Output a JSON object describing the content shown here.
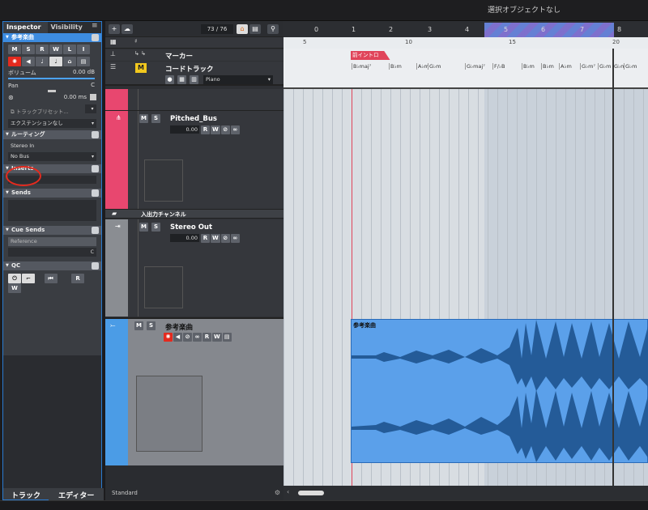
{
  "topbar": {
    "status": "選択オブジェクトなし"
  },
  "inspector": {
    "tabs": [
      "Inspector",
      "Visibility"
    ],
    "track_title": "参考楽曲",
    "buttons_row": [
      "M",
      "S",
      "R",
      "W",
      "L",
      "I"
    ],
    "volume_label": "ボリューム",
    "volume_value": "0.00 dB",
    "pan_label": "Pan",
    "pan_value": "C",
    "delay_value": "0.00 ms",
    "preset_label": "トラックプリセット...",
    "extension_label": "エクステンションなし",
    "routing_label": "ルーティング",
    "input_label": "Stereo In",
    "output_label": "No Bus",
    "inserts_label": "Inserts",
    "sends_label": "Sends",
    "cue_sends_label": "Cue Sends",
    "reference_label": "Reference",
    "reference_pan": "C",
    "qc_label": "QC",
    "qc_r": "R",
    "qc_w": "W",
    "bottom_tabs": [
      "トラック",
      "エディター"
    ]
  },
  "toolbar": {
    "counter": "73 / 76",
    "add_label": "+"
  },
  "tracks": {
    "marker": {
      "name": "マーカー"
    },
    "chord": {
      "name": "コードトラック",
      "instrument": "Piano",
      "m_label": "M"
    },
    "pitched": {
      "name": "Pitched_Bus",
      "volume": "0.00",
      "m": "M",
      "s": "S",
      "r": "R",
      "w": "W"
    },
    "io_folder": {
      "name": "入出力チャンネル"
    },
    "stereo_out": {
      "name": "Stereo Out",
      "volume": "0.00",
      "m": "M",
      "s": "S",
      "r": "R",
      "w": "W"
    },
    "audio": {
      "name": "参考楽曲",
      "m": "M",
      "s": "S",
      "r": "R",
      "w": "W"
    },
    "bottom_label": "Standard"
  },
  "timeline": {
    "bars_top": [
      "0",
      "1",
      "2",
      "3",
      "4",
      "5",
      "6",
      "7",
      "8"
    ],
    "bars_sub": [
      "5",
      "10",
      "15",
      "20"
    ],
    "marker_label": "前イントロ",
    "chords": [
      "B♭maj⁷",
      "B♭m",
      "A♭m",
      "G♭m",
      "G♭maj⁷",
      "F/♭B",
      "B♭m",
      "B♭m",
      "A♭m",
      "G♭m⁷",
      "G♭m",
      "G♭m",
      "G♭m"
    ],
    "clip_name": "参考楽曲"
  },
  "colors": {
    "accent": "#3d8ce0",
    "pink_track": "#e8476f",
    "audio_track": "#4b9ce6",
    "clip_fill": "#5ba0ea",
    "waveform": "#245b98",
    "record": "#e42a1e"
  }
}
